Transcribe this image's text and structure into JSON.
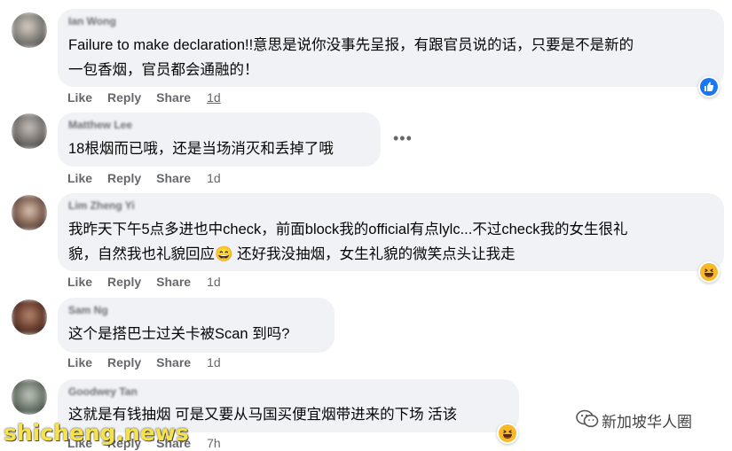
{
  "comments": [
    {
      "name": "Ian Wong",
      "lines": [
        "Failure to make declaration!!意思是说你没事先呈报，有跟官员说的话，只要是不是新的",
        "一包香烟，官员都会通融的！"
      ],
      "like": "Like",
      "reply": "Reply",
      "share": "Share",
      "time": "1d",
      "reaction": "like-icon"
    },
    {
      "name": "Matthew Lee",
      "lines": [
        "18根烟而已哦，还是当场消灭和丢掉了哦"
      ],
      "like": "Like",
      "reply": "Reply",
      "share": "Share",
      "time": "1d",
      "more": "•••"
    },
    {
      "name": "Lim Zheng Yi",
      "lines": [
        "我昨天下午5点多进也中check，前面block我的official有点lylc...不过check我的女生很礼",
        "貌，自然我也礼貌回应😄 还好我没抽烟，女生礼貌的微笑点头让我走"
      ],
      "like": "Like",
      "reply": "Reply",
      "share": "Share",
      "time": "1d",
      "reaction": "haha-icon"
    },
    {
      "name": "Sam Ng",
      "lines": [
        "这个是搭巴士过关卡被Scan 到吗?"
      ],
      "like": "Like",
      "reply": "Reply",
      "share": "Share",
      "time": "1d"
    },
    {
      "name": "Goodwey Tan",
      "lines": [
        "这就是有钱抽烟 可是又要从马国买便宜烟带进来的下场 活该"
      ],
      "like": "Like",
      "reply": "Reply",
      "share": "Share",
      "time": "7h",
      "reaction": "haha-icon"
    }
  ],
  "watermark": "shicheng.news",
  "wechat_label": "新加坡华人圈",
  "colors": {
    "bubble": "#f0f2f5",
    "meta": "#65676b",
    "like_blue": "#1877f2",
    "haha_yellow": "#f7b928",
    "watermark": "#f6e24b"
  }
}
